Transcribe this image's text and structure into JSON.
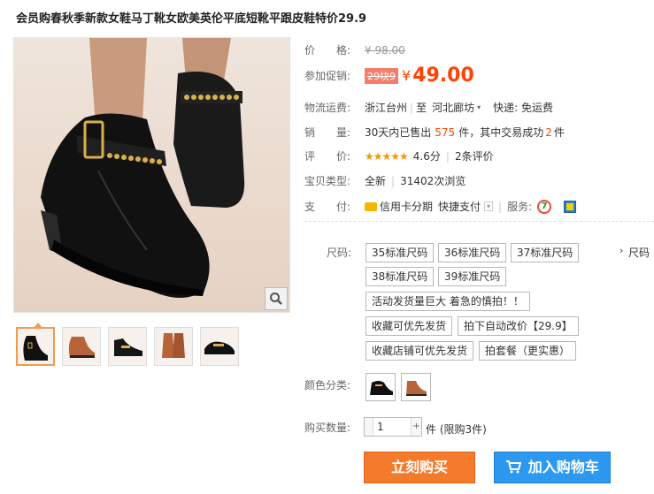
{
  "product": {
    "title": "会员购春秋季新款女鞋马丁靴女欧美英伦平底短靴平跟皮鞋特价29.9"
  },
  "price": {
    "label": "价　　格:",
    "original": "¥ 98.00",
    "promo_label": "参加促销:",
    "promo_badge": "29块9",
    "currency": "¥",
    "current": "49.00"
  },
  "shipping": {
    "label": "物流运费:",
    "origin": "浙江台州",
    "to": "至",
    "destination": "河北廊坊",
    "fee": "快递: 免运费"
  },
  "sales": {
    "label": "销　　量:",
    "prefix": "30天内已售出",
    "count": "575",
    "mid": "件，其中交易成功",
    "success": "2",
    "suffix": "件"
  },
  "rating": {
    "label": "评　　价:",
    "stars": "★★★★★",
    "score": "4.6分",
    "reviews": "2条评价"
  },
  "type": {
    "label": "宝贝类型:",
    "value": "全新",
    "views": "31402次浏览"
  },
  "payment": {
    "label": "支　　付:",
    "credit": "信用卡分期",
    "quick": "快捷支付",
    "service_label": "服务:",
    "service_badge": "7"
  },
  "size": {
    "label": "尺码:",
    "options": [
      "35标准尺码",
      "36标准尺码",
      "37标准尺码",
      "38标准尺码",
      "39标准尺码"
    ],
    "overflow": "尺码",
    "notes": [
      "活动发货量巨大 着急的慎拍！！",
      "收藏可优先发货",
      "拍下自动改价【29.9】",
      "收藏店铺可优先发货",
      "拍套餐（更实惠）"
    ]
  },
  "color": {
    "label": "颜色分类:",
    "options": [
      "black-boot",
      "brown-boot"
    ]
  },
  "quantity": {
    "label": "购买数量:",
    "value": "1",
    "limit": "件 (限购3件)"
  },
  "actions": {
    "buy": "立刻购买",
    "cart": "加入购物车"
  },
  "colors": {
    "accent": "#ff4400",
    "buy_button": "#f47a2c",
    "cart_button": "#2d98f0"
  }
}
